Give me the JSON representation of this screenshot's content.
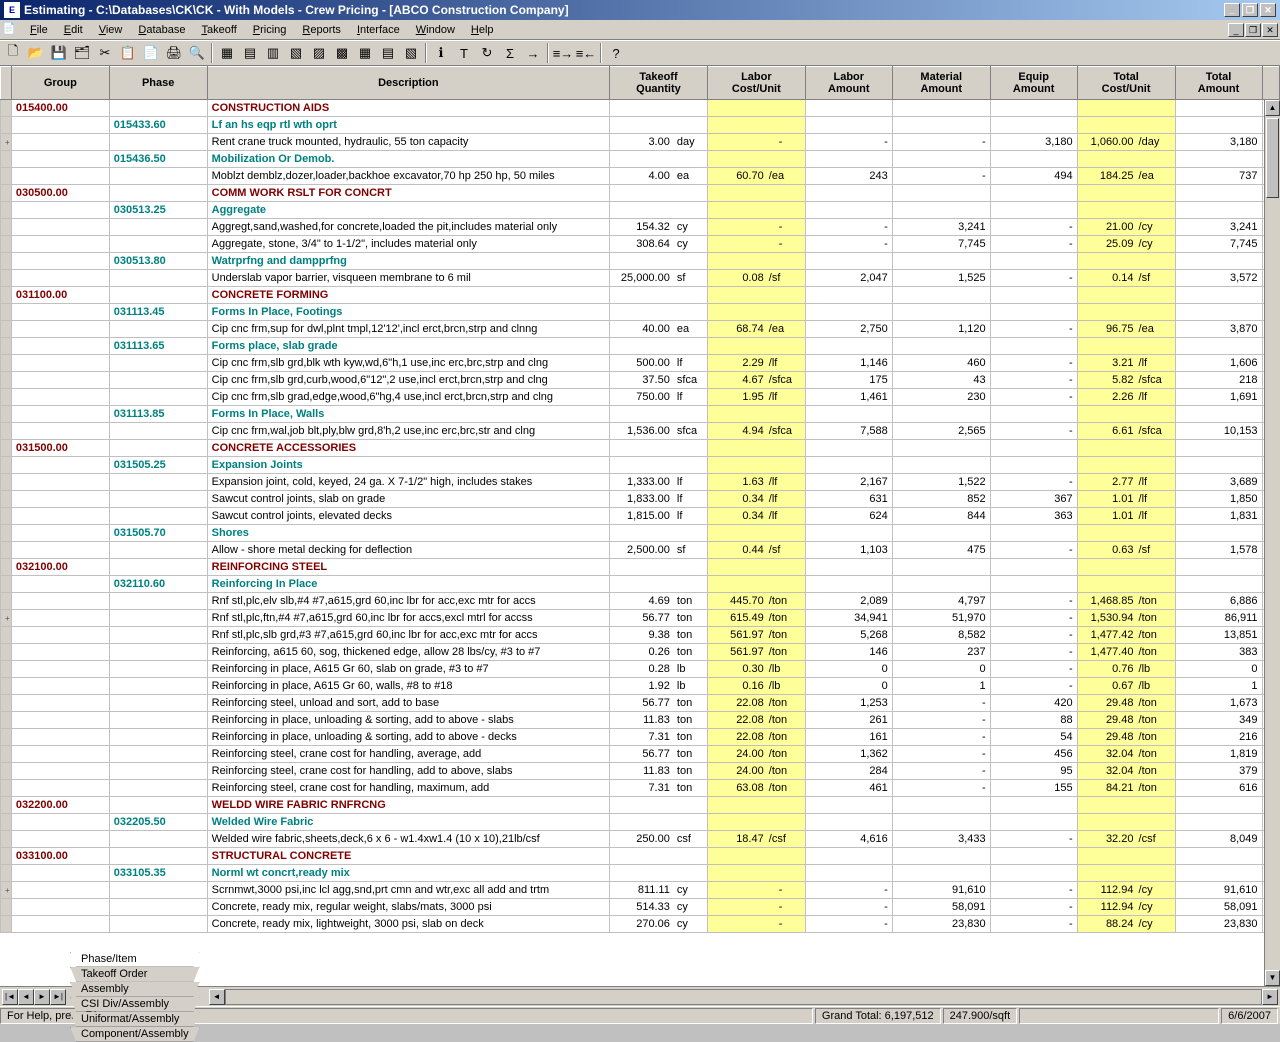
{
  "window": {
    "title": "Estimating - C:\\Databases\\CK\\CK - With Models - Crew Pricing - [ABCO Construction Company]",
    "controls": {
      "min": "_",
      "max": "❐",
      "close": "✕"
    }
  },
  "menu": [
    "File",
    "Edit",
    "View",
    "Database",
    "Takeoff",
    "Pricing",
    "Reports",
    "Interface",
    "Window",
    "Help"
  ],
  "toolbar_icons": [
    "new",
    "open",
    "save",
    "organize",
    "cut",
    "copy",
    "paste",
    "print",
    "preview",
    "sep",
    "t1",
    "t2",
    "t3",
    "t4",
    "t5",
    "t6",
    "t7",
    "t8",
    "t9",
    "sep",
    "ti",
    "tt",
    "refresh",
    "sum",
    "go",
    "sep",
    "seq1",
    "seq2",
    "sep",
    "help"
  ],
  "columns": [
    "Group",
    "Phase",
    "Description",
    "Takeoff\nQuantity",
    "Labor\nCost/Unit",
    "Labor\nAmount",
    "Material\nAmount",
    "Equip\nAmount",
    "Total\nCost/Unit",
    "Total\nAmount"
  ],
  "rows": [
    {
      "type": "group",
      "group": "015400.00",
      "desc": "CONSTRUCTION AIDS"
    },
    {
      "type": "sub",
      "phase": "015433.60",
      "desc": "Lf an hs eqp rtl wth oprt"
    },
    {
      "type": "item",
      "plus": true,
      "desc": "Rent crane truck mounted, hydraulic, 55 ton capacity",
      "qty": "3.00",
      "unit": "day",
      "lcu": "-",
      "lam": "-",
      "mam": "-",
      "eam": "3,180",
      "tcu": "1,060.00",
      "tunit": "/day",
      "tam": "3,180"
    },
    {
      "type": "sub",
      "phase": "015436.50",
      "desc": "Mobilization Or Demob."
    },
    {
      "type": "item",
      "desc": "Moblzt demblz,dozer,loader,backhoe excavator,70 hp 250 hp, 50 miles",
      "qty": "4.00",
      "unit": "ea",
      "lcu": "60.70",
      "lunit": "/ea",
      "lam": "243",
      "mam": "-",
      "eam": "494",
      "tcu": "184.25",
      "tunit": "/ea",
      "tam": "737"
    },
    {
      "type": "group",
      "group": "030500.00",
      "desc": "COMM WORK RSLT FOR CONCRT"
    },
    {
      "type": "sub",
      "phase": "030513.25",
      "desc": "Aggregate"
    },
    {
      "type": "item",
      "desc": "Aggregt,sand,washed,for concrete,loaded the pit,includes material only",
      "qty": "154.32",
      "unit": "cy",
      "lcu": "-",
      "lam": "-",
      "mam": "3,241",
      "eam": "-",
      "tcu": "21.00",
      "tunit": "/cy",
      "tam": "3,241"
    },
    {
      "type": "item",
      "desc": "Aggregate, stone, 3/4\" to 1-1/2\", includes material only",
      "qty": "308.64",
      "unit": "cy",
      "lcu": "-",
      "lam": "-",
      "mam": "7,745",
      "eam": "-",
      "tcu": "25.09",
      "tunit": "/cy",
      "tam": "7,745"
    },
    {
      "type": "sub",
      "phase": "030513.80",
      "desc": "Watrprfng and dampprfng"
    },
    {
      "type": "item",
      "desc": "Underslab vapor barrier, visqueen membrane to 6 mil",
      "qty": "25,000.00",
      "unit": "sf",
      "lcu": "0.08",
      "lunit": "/sf",
      "lam": "2,047",
      "mam": "1,525",
      "eam": "-",
      "tcu": "0.14",
      "tunit": "/sf",
      "tam": "3,572"
    },
    {
      "type": "group",
      "group": "031100.00",
      "desc": "CONCRETE FORMING"
    },
    {
      "type": "sub",
      "phase": "031113.45",
      "desc": "Forms In Place, Footings"
    },
    {
      "type": "item",
      "desc": "Cip cnc frm,sup for dwl,plnt tmpl,12'12',incl erct,brcn,strp and clnng",
      "qty": "40.00",
      "unit": "ea",
      "lcu": "68.74",
      "lunit": "/ea",
      "lam": "2,750",
      "mam": "1,120",
      "eam": "-",
      "tcu": "96.75",
      "tunit": "/ea",
      "tam": "3,870"
    },
    {
      "type": "sub",
      "phase": "031113.65",
      "desc": "Forms place, slab grade"
    },
    {
      "type": "item",
      "desc": "Cip cnc frm,slb grd,blk wth kyw,wd,6\"h,1 use,inc erc,brc,strp and clng",
      "qty": "500.00",
      "unit": "lf",
      "lcu": "2.29",
      "lunit": "/lf",
      "lam": "1,146",
      "mam": "460",
      "eam": "-",
      "tcu": "3.21",
      "tunit": "/lf",
      "tam": "1,606"
    },
    {
      "type": "item",
      "desc": "Cip cnc frm,slb grd,curb,wood,6\"12\",2 use,incl erct,brcn,strp and clng",
      "qty": "37.50",
      "unit": "sfca",
      "lcu": "4.67",
      "lunit": "/sfca",
      "lam": "175",
      "mam": "43",
      "eam": "-",
      "tcu": "5.82",
      "tunit": "/sfca",
      "tam": "218"
    },
    {
      "type": "item",
      "desc": "Cip cnc frm,slb grad,edge,wood,6\"hg,4 use,incl erct,brcn,strp and clng",
      "qty": "750.00",
      "unit": "lf",
      "lcu": "1.95",
      "lunit": "/lf",
      "lam": "1,461",
      "mam": "230",
      "eam": "-",
      "tcu": "2.26",
      "tunit": "/lf",
      "tam": "1,691"
    },
    {
      "type": "sub",
      "phase": "031113.85",
      "desc": "Forms In Place, Walls"
    },
    {
      "type": "item",
      "desc": "Cip cnc frm,wal,job blt,ply,blw grd,8'h,2 use,inc erc,brc,str and clng",
      "qty": "1,536.00",
      "unit": "sfca",
      "lcu": "4.94",
      "lunit": "/sfca",
      "lam": "7,588",
      "mam": "2,565",
      "eam": "-",
      "tcu": "6.61",
      "tunit": "/sfca",
      "tam": "10,153"
    },
    {
      "type": "group",
      "group": "031500.00",
      "desc": "CONCRETE ACCESSORIES"
    },
    {
      "type": "sub",
      "phase": "031505.25",
      "desc": "Expansion Joints"
    },
    {
      "type": "item",
      "desc": "Expansion joint, cold, keyed, 24 ga. X 7-1/2\" high, includes stakes",
      "qty": "1,333.00",
      "unit": "lf",
      "lcu": "1.63",
      "lunit": "/lf",
      "lam": "2,167",
      "mam": "1,522",
      "eam": "-",
      "tcu": "2.77",
      "tunit": "/lf",
      "tam": "3,689"
    },
    {
      "type": "item",
      "desc": "Sawcut control joints, slab on grade",
      "qty": "1,833.00",
      "unit": "lf",
      "lcu": "0.34",
      "lunit": "/lf",
      "lam": "631",
      "mam": "852",
      "eam": "367",
      "tcu": "1.01",
      "tunit": "/lf",
      "tam": "1,850"
    },
    {
      "type": "item",
      "desc": "Sawcut control joints, elevated decks",
      "qty": "1,815.00",
      "unit": "lf",
      "lcu": "0.34",
      "lunit": "/lf",
      "lam": "624",
      "mam": "844",
      "eam": "363",
      "tcu": "1.01",
      "tunit": "/lf",
      "tam": "1,831"
    },
    {
      "type": "sub",
      "phase": "031505.70",
      "desc": "Shores"
    },
    {
      "type": "item",
      "desc": "Allow - shore metal decking for deflection",
      "qty": "2,500.00",
      "unit": "sf",
      "lcu": "0.44",
      "lunit": "/sf",
      "lam": "1,103",
      "mam": "475",
      "eam": "-",
      "tcu": "0.63",
      "tunit": "/sf",
      "tam": "1,578"
    },
    {
      "type": "group",
      "group": "032100.00",
      "desc": "REINFORCING STEEL"
    },
    {
      "type": "sub",
      "phase": "032110.60",
      "desc": "Reinforcing In Place"
    },
    {
      "type": "item",
      "desc": "Rnf stl,plc,elv slb,#4 #7,a615,grd 60,inc lbr for acc,exc mtr for accs",
      "qty": "4.69",
      "unit": "ton",
      "lcu": "445.70",
      "lunit": "/ton",
      "lam": "2,089",
      "mam": "4,797",
      "eam": "-",
      "tcu": "1,468.85",
      "tunit": "/ton",
      "tam": "6,886"
    },
    {
      "type": "item",
      "plus": true,
      "desc": "Rnf stl,plc,ftn,#4 #7,a615,grd 60,inc lbr for accs,excl mtrl for accss",
      "qty": "56.77",
      "unit": "ton",
      "lcu": "615.49",
      "lunit": "/ton",
      "lam": "34,941",
      "mam": "51,970",
      "eam": "-",
      "tcu": "1,530.94",
      "tunit": "/ton",
      "tam": "86,911"
    },
    {
      "type": "item",
      "desc": "Rnf stl,plc,slb grd,#3 #7,a615,grd 60,inc lbr for acc,exc mtr for accs",
      "qty": "9.38",
      "unit": "ton",
      "lcu": "561.97",
      "lunit": "/ton",
      "lam": "5,268",
      "mam": "8,582",
      "eam": "-",
      "tcu": "1,477.42",
      "tunit": "/ton",
      "tam": "13,851"
    },
    {
      "type": "item",
      "desc": "Reinforcing, a615 60, sog, thickened edge, allow 28 lbs/cy, #3 to #7",
      "qty": "0.26",
      "unit": "ton",
      "lcu": "561.97",
      "lunit": "/ton",
      "lam": "146",
      "mam": "237",
      "eam": "-",
      "tcu": "1,477.40",
      "tunit": "/ton",
      "tam": "383"
    },
    {
      "type": "item",
      "desc": "Reinforcing in place, A615 Gr 60, slab on grade, #3 to #7",
      "qty": "0.28",
      "unit": "lb",
      "lcu": "0.30",
      "lunit": "/lb",
      "lam": "0",
      "mam": "0",
      "eam": "-",
      "tcu": "0.76",
      "tunit": "/lb",
      "tam": "0"
    },
    {
      "type": "item",
      "desc": "Reinforcing in place, A615 Gr 60, walls, #8 to #18",
      "qty": "1.92",
      "unit": "lb",
      "lcu": "0.16",
      "lunit": "/lb",
      "lam": "0",
      "mam": "1",
      "eam": "-",
      "tcu": "0.67",
      "tunit": "/lb",
      "tam": "1"
    },
    {
      "type": "item",
      "desc": "Reinforcing steel, unload and sort, add to base",
      "qty": "56.77",
      "unit": "ton",
      "lcu": "22.08",
      "lunit": "/ton",
      "lam": "1,253",
      "mam": "-",
      "eam": "420",
      "tcu": "29.48",
      "tunit": "/ton",
      "tam": "1,673"
    },
    {
      "type": "item",
      "desc": "Reinforcing in place, unloading & sorting, add to above - slabs",
      "qty": "11.83",
      "unit": "ton",
      "lcu": "22.08",
      "lunit": "/ton",
      "lam": "261",
      "mam": "-",
      "eam": "88",
      "tcu": "29.48",
      "tunit": "/ton",
      "tam": "349"
    },
    {
      "type": "item",
      "desc": "Reinforcing in place, unloading & sorting, add to above - decks",
      "qty": "7.31",
      "unit": "ton",
      "lcu": "22.08",
      "lunit": "/ton",
      "lam": "161",
      "mam": "-",
      "eam": "54",
      "tcu": "29.48",
      "tunit": "/ton",
      "tam": "216"
    },
    {
      "type": "item",
      "desc": "Reinforcing steel, crane cost for handling, average, add",
      "qty": "56.77",
      "unit": "ton",
      "lcu": "24.00",
      "lunit": "/ton",
      "lam": "1,362",
      "mam": "-",
      "eam": "456",
      "tcu": "32.04",
      "tunit": "/ton",
      "tam": "1,819"
    },
    {
      "type": "item",
      "desc": "Reinforcing steel, crane cost for handling, add to above, slabs",
      "qty": "11.83",
      "unit": "ton",
      "lcu": "24.00",
      "lunit": "/ton",
      "lam": "284",
      "mam": "-",
      "eam": "95",
      "tcu": "32.04",
      "tunit": "/ton",
      "tam": "379"
    },
    {
      "type": "item",
      "desc": "Reinforcing steel, crane cost for handling, maximum, add",
      "qty": "7.31",
      "unit": "ton",
      "lcu": "63.08",
      "lunit": "/ton",
      "lam": "461",
      "mam": "-",
      "eam": "155",
      "tcu": "84.21",
      "tunit": "/ton",
      "tam": "616"
    },
    {
      "type": "group",
      "group": "032200.00",
      "desc": "WELDD WIRE FABRIC RNFRCNG"
    },
    {
      "type": "sub",
      "phase": "032205.50",
      "desc": "Welded Wire Fabric"
    },
    {
      "type": "item",
      "desc": "Welded wire fabric,sheets,deck,6 x 6 - w1.4xw1.4 (10 x 10),21lb/csf",
      "qty": "250.00",
      "unit": "csf",
      "lcu": "18.47",
      "lunit": "/csf",
      "lam": "4,616",
      "mam": "3,433",
      "eam": "-",
      "tcu": "32.20",
      "tunit": "/csf",
      "tam": "8,049"
    },
    {
      "type": "group",
      "group": "033100.00",
      "desc": "STRUCTURAL CONCRETE"
    },
    {
      "type": "sub",
      "phase": "033105.35",
      "desc": "Norml wt concrt,ready mix"
    },
    {
      "type": "item",
      "plus": true,
      "desc": "Scrnmwt,3000 psi,inc lcl agg,snd,prt cmn and wtr,exc all add and trtm",
      "qty": "811.11",
      "unit": "cy",
      "lcu": "-",
      "lam": "-",
      "mam": "91,610",
      "eam": "-",
      "tcu": "112.94",
      "tunit": "/cy",
      "tam": "91,610"
    },
    {
      "type": "item",
      "desc": "Concrete, ready mix, regular weight, slabs/mats, 3000 psi",
      "qty": "514.33",
      "unit": "cy",
      "lcu": "-",
      "lam": "-",
      "mam": "58,091",
      "eam": "-",
      "tcu": "112.94",
      "tunit": "/cy",
      "tam": "58,091"
    },
    {
      "type": "item",
      "desc": "Concrete, ready mix, lightweight, 3000 psi, slab on deck",
      "qty": "270.06",
      "unit": "cy",
      "lcu": "-",
      "lam": "-",
      "mam": "23,830",
      "eam": "-",
      "tcu": "88.24",
      "tunit": "/cy",
      "tam": "23,830"
    }
  ],
  "tabs": [
    "Phase/Item",
    "Takeoff Order",
    "Assembly",
    "CSI Div/Assembly",
    "Uniformat/Assembly",
    "Component/Assembly"
  ],
  "statusbar": {
    "help": "For Help, press F1",
    "grand_total": "Grand Total: 6,197,512",
    "rate": "247.900/sqft",
    "date": "6/6/2007"
  }
}
